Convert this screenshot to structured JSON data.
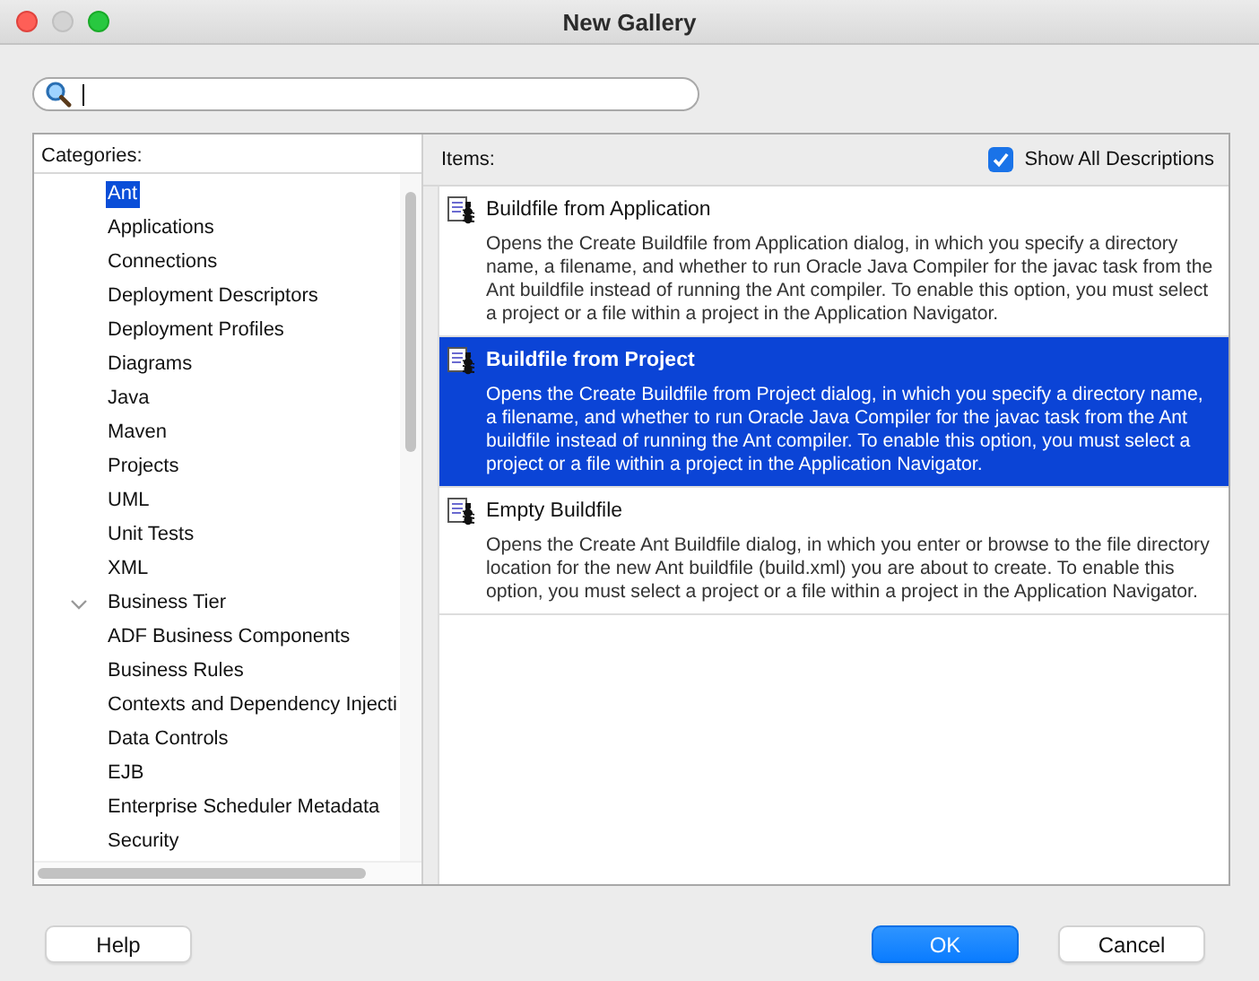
{
  "window": {
    "title": "New Gallery"
  },
  "search": {
    "focused": true
  },
  "categories": {
    "label": "Categories:",
    "items": [
      {
        "children": [
          {
            "label": "Ant",
            "selected": true
          },
          {
            "label": "Applications",
            "selected": false
          },
          {
            "label": "Connections",
            "selected": false
          },
          {
            "label": "Deployment Descriptors",
            "selected": false
          },
          {
            "label": "Deployment Profiles",
            "selected": false
          },
          {
            "label": "Diagrams",
            "selected": false
          },
          {
            "label": "Java",
            "selected": false
          },
          {
            "label": "Maven",
            "selected": false
          },
          {
            "label": "Projects",
            "selected": false
          },
          {
            "label": "UML",
            "selected": false
          },
          {
            "label": "Unit Tests",
            "selected": false
          },
          {
            "label": "XML",
            "selected": false
          }
        ]
      },
      {
        "label": "Business Tier",
        "selected": false,
        "expanded": true,
        "children": [
          {
            "label": "ADF Business Components",
            "selected": false
          },
          {
            "label": "Business Rules",
            "selected": false
          },
          {
            "label": "Contexts and Dependency Injecti",
            "selected": false
          },
          {
            "label": "Data Controls",
            "selected": false
          },
          {
            "label": "EJB",
            "selected": false
          },
          {
            "label": "Enterprise Scheduler Metadata",
            "selected": false
          },
          {
            "label": "Security",
            "selected": false
          }
        ]
      }
    ]
  },
  "items": {
    "label": "Items:",
    "show_all_descriptions": {
      "label": "Show All Descriptions",
      "checked": true
    },
    "list": [
      {
        "title": "Buildfile from Application",
        "selected": false,
        "description": "Opens the Create Buildfile from Application dialog, in which you specify a directory name, a filename, and whether to run Oracle Java Compiler for the javac task from the Ant buildfile instead of running the Ant compiler. To enable this option, you must select a project or a file within a project in the Application Navigator."
      },
      {
        "title": "Buildfile from Project",
        "selected": true,
        "description": "Opens the Create Buildfile from Project dialog, in which you specify a directory name, a filename, and whether to run Oracle Java Compiler for the javac task from the Ant buildfile instead of running the Ant compiler. To enable this option, you must select a project or a file within a project in the Application Navigator."
      },
      {
        "title": "Empty Buildfile",
        "selected": false,
        "description": "Opens the Create Ant Buildfile dialog, in which you enter or browse to the file directory location for the new Ant buildfile (build.xml) you are about to create. To enable this option, you must select a project or a file within a project in the Application Navigator."
      }
    ]
  },
  "buttons": [
    {
      "label": "Help",
      "default": false
    },
    {
      "label": "OK",
      "default": true
    },
    {
      "label": "Cancel",
      "default": false
    }
  ]
}
